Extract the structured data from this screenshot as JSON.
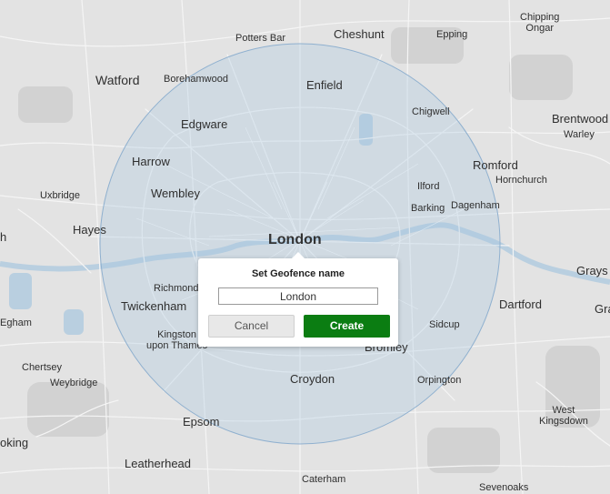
{
  "map": {
    "places": [
      {
        "id": "chipping-ongar",
        "lines": [
          "Chipping",
          "Ongar"
        ],
        "size": "small"
      },
      {
        "id": "potters-bar",
        "lines": [
          "Potters Bar"
        ],
        "size": "small"
      },
      {
        "id": "cheshunt",
        "lines": [
          "Cheshunt"
        ],
        "size": "mid"
      },
      {
        "id": "epping",
        "lines": [
          "Epping"
        ],
        "size": "small"
      },
      {
        "id": "watford",
        "lines": [
          "Watford"
        ],
        "size": "big"
      },
      {
        "id": "borehamwood",
        "lines": [
          "Borehamwood"
        ],
        "size": "small"
      },
      {
        "id": "enfield",
        "lines": [
          "Enfield"
        ],
        "size": "mid"
      },
      {
        "id": "chigwell",
        "lines": [
          "Chigwell"
        ],
        "size": "small"
      },
      {
        "id": "brentwood",
        "lines": [
          "Brentwood"
        ],
        "size": "mid"
      },
      {
        "id": "warley",
        "lines": [
          "Warley"
        ],
        "size": "small"
      },
      {
        "id": "edgware",
        "lines": [
          "Edgware"
        ],
        "size": "mid"
      },
      {
        "id": "harrow",
        "lines": [
          "Harrow"
        ],
        "size": "mid"
      },
      {
        "id": "romford",
        "lines": [
          "Romford"
        ],
        "size": "mid"
      },
      {
        "id": "hornchurch",
        "lines": [
          "Hornchurch"
        ],
        "size": "small"
      },
      {
        "id": "uxbridge",
        "lines": [
          "Uxbridge"
        ],
        "size": "small"
      },
      {
        "id": "wembley",
        "lines": [
          "Wembley"
        ],
        "size": "mid"
      },
      {
        "id": "ilford",
        "lines": [
          "Ilford"
        ],
        "size": "small"
      },
      {
        "id": "barking",
        "lines": [
          "Barking"
        ],
        "size": "small"
      },
      {
        "id": "dagenham",
        "lines": [
          "Dagenham"
        ],
        "size": "small"
      },
      {
        "id": "hayes",
        "lines": [
          "Hayes"
        ],
        "size": "mid"
      },
      {
        "id": "london",
        "lines": [
          "London"
        ],
        "size": "capital"
      },
      {
        "id": "grays",
        "lines": [
          "Grays"
        ],
        "size": "mid"
      },
      {
        "id": "richmond",
        "lines": [
          "Richmond"
        ],
        "size": "small"
      },
      {
        "id": "twickenham",
        "lines": [
          "Twickenham"
        ],
        "size": "mid"
      },
      {
        "id": "dartford",
        "lines": [
          "Dartford"
        ],
        "size": "mid"
      },
      {
        "id": "gra",
        "lines": [
          "Gra"
        ],
        "size": "mid"
      },
      {
        "id": "egham",
        "lines": [
          "Egham"
        ],
        "size": "small"
      },
      {
        "id": "sidcup",
        "lines": [
          "Sidcup"
        ],
        "size": "small"
      },
      {
        "id": "kingston",
        "lines": [
          "Kingston",
          "upon Thames"
        ],
        "size": "small"
      },
      {
        "id": "bromley",
        "lines": [
          "Bromley"
        ],
        "size": "mid"
      },
      {
        "id": "chertsey",
        "lines": [
          "Chertsey"
        ],
        "size": "small"
      },
      {
        "id": "weybridge",
        "lines": [
          "Weybridge"
        ],
        "size": "small"
      },
      {
        "id": "croydon",
        "lines": [
          "Croydon"
        ],
        "size": "mid"
      },
      {
        "id": "orpington",
        "lines": [
          "Orpington"
        ],
        "size": "small"
      },
      {
        "id": "west-kingsdown",
        "lines": [
          "West",
          "Kingsdown"
        ],
        "size": "small"
      },
      {
        "id": "epsom",
        "lines": [
          "Epsom"
        ],
        "size": "mid"
      },
      {
        "id": "oking",
        "lines": [
          "oking"
        ],
        "size": "mid"
      },
      {
        "id": "leatherhead",
        "lines": [
          "Leatherhead"
        ],
        "size": "mid"
      },
      {
        "id": "caterham",
        "lines": [
          "Caterham"
        ],
        "size": "small"
      },
      {
        "id": "sevenoaks",
        "lines": [
          "Sevenoaks"
        ],
        "size": "small"
      },
      {
        "id": "h-edge",
        "lines": [
          "h"
        ],
        "size": "mid"
      }
    ],
    "geofence_color": "#a9c6e0"
  },
  "popup": {
    "title": "Set Geofence name",
    "name_value": "London",
    "cancel_label": "Cancel",
    "create_label": "Create",
    "create_color": "#0b7d12"
  }
}
